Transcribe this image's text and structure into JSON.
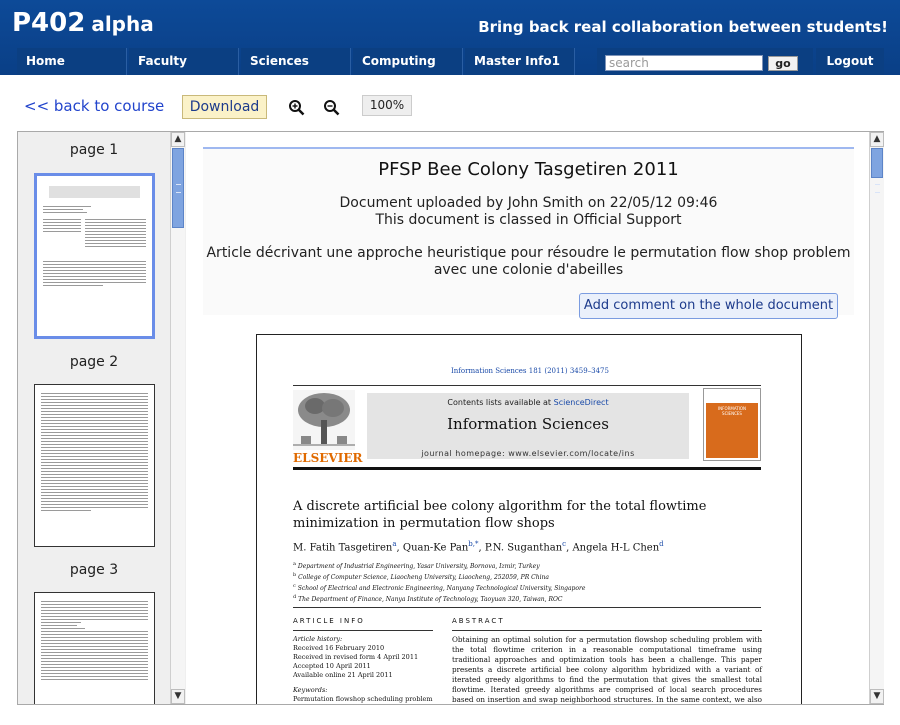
{
  "header": {
    "brand_main": "P402",
    "brand_sub": "alpha",
    "tagline": "Bring back real collaboration between students!"
  },
  "nav": {
    "items": [
      "Home",
      "Faculty",
      "Sciences",
      "Computing",
      "Master Info1"
    ],
    "search_placeholder": "search",
    "go_label": "go",
    "logout_label": "Logout"
  },
  "toolbar": {
    "back_label": "<< back to course",
    "download_label": "Download",
    "zoom_in_icon": "zoom-in-icon",
    "zoom_out_icon": "zoom-out-icon",
    "zoom_level": "100%"
  },
  "thumbnails": {
    "pages": [
      "page 1",
      "page 2",
      "page 3"
    ],
    "selected_index": 0
  },
  "document": {
    "title": "PFSP Bee Colony Tasgetiren 2011",
    "uploaded": "Document uploaded by John Smith on 22/05/12 09:46",
    "classed": "This document is classed in Official Support",
    "desc_line1": "Article décrivant une approche heuristique pour résoudre le permutation flow shop problem",
    "desc_line2": "avec une colonie d'abeilles",
    "comment_button": "Add comment on the whole document"
  },
  "paper": {
    "journal_ref": "Information Sciences 181 (2011) 3459–3475",
    "contents_prefix": "Contents lists available at ",
    "contents_link": "ScienceDirect",
    "journal_name": "Information Sciences",
    "homepage": "journal homepage: www.elsevier.com/locate/ins",
    "publisher": "ELSEVIER",
    "cover_text": "INFORMATION SCIENCES",
    "title_line1": "A discrete artificial bee colony algorithm for the total flowtime",
    "title_line2": "minimization in permutation flow shops",
    "authors": [
      {
        "name": "M. Fatih Tasgetiren",
        "sup": "a"
      },
      {
        "name": "Quan-Ke Pan",
        "sup": "b,*"
      },
      {
        "name": "P.N. Suganthan",
        "sup": "c"
      },
      {
        "name": "Angela H-L Chen",
        "sup": "d"
      }
    ],
    "affiliations": [
      {
        "sup": "a",
        "text": "Department of Industrial Engineering, Yasar University, Bornova, Izmir, Turkey"
      },
      {
        "sup": "b",
        "text": "College of Computer Science, Liaocheng University, Liaocheng, 252059, PR China"
      },
      {
        "sup": "c",
        "text": "School of Electrical and Electronic Engineering, Nanyang Technological University, Singapore"
      },
      {
        "sup": "d",
        "text": "The Department of Finance, Nanya Institute of Technology, Taoyuan 320, Taiwan, ROC"
      }
    ],
    "article_info_head": "ARTICLE INFO",
    "abstract_head": "ABSTRACT",
    "history_label": "Article history:",
    "history": [
      "Received 16 February 2010",
      "Received in revised form 4 April 2011",
      "Accepted 10 April 2011",
      "Available online 21 April 2011"
    ],
    "keywords_label": "Keywords:",
    "keywords_first": "Permutation flowshop scheduling problem",
    "abstract": "Obtaining an optimal solution for a permutation flowshop scheduling problem with the total flowtime criterion in a reasonable computational timeframe using traditional approaches and optimization tools has been a challenge. This paper presents a discrete artificial bee colony algorithm hybridized with a variant of iterated greedy algorithms to find the permutation that gives the smallest total flowtime. Iterated greedy algorithms are comprised of local search procedures based on insertion and swap neighborhood structures. In the same context, we also consider a discrete differential evolution algorithm from"
  }
}
